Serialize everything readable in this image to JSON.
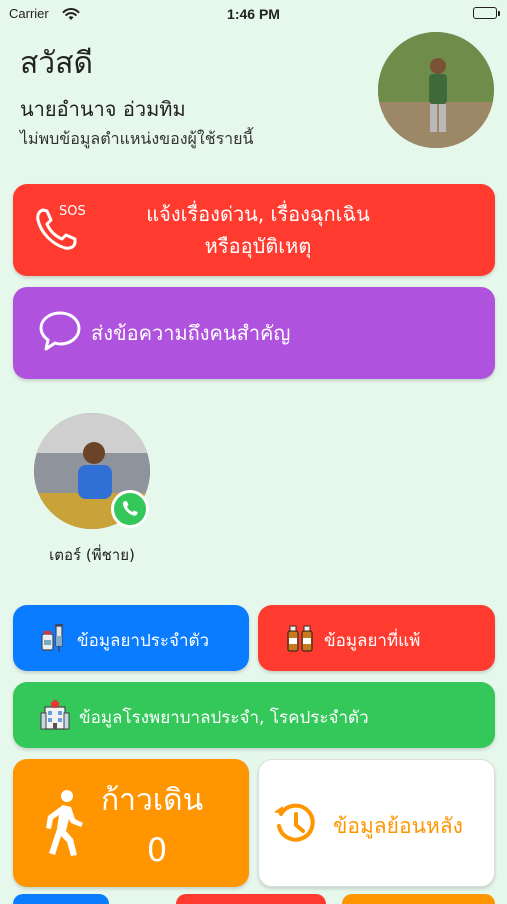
{
  "status_bar": {
    "carrier": "Carrier",
    "time": "1:46 PM"
  },
  "header": {
    "greeting": "สวัสดี",
    "user_name": "นายอำนาจ อ่วมทิม",
    "location_message": "ไม่พบข้อมูลตำแหน่งของผู้ใช้รายนี้"
  },
  "sos_button": {
    "tag": "SOS",
    "line1": "แจ้งเรื่องด่วน, เรื่องฉุกเฉิน",
    "line2": "หรืออุบัติเหตุ",
    "color": "#ff3b30"
  },
  "message_button": {
    "label": "ส่งข้อความถึงคนสำคัญ",
    "color": "#af52de"
  },
  "contacts": [
    {
      "name": "เตอร์ (พี่ชาย)"
    }
  ],
  "info_buttons": {
    "medication": {
      "label": "ข้อมูลยาประจำตัว",
      "color": "#0a7cff"
    },
    "allergy": {
      "label": "ข้อมูลยาที่แพ้",
      "color": "#ff3b30"
    },
    "hospital": {
      "label": "ข้อมูลโรงพยาบาลประจำ, โรคประจำตัว",
      "color": "#34c759"
    }
  },
  "steps": {
    "label": "ก้าวเดิน",
    "count": "0",
    "color": "#ff9500"
  },
  "history": {
    "label": "ข้อมูลย้อนหลัง"
  }
}
